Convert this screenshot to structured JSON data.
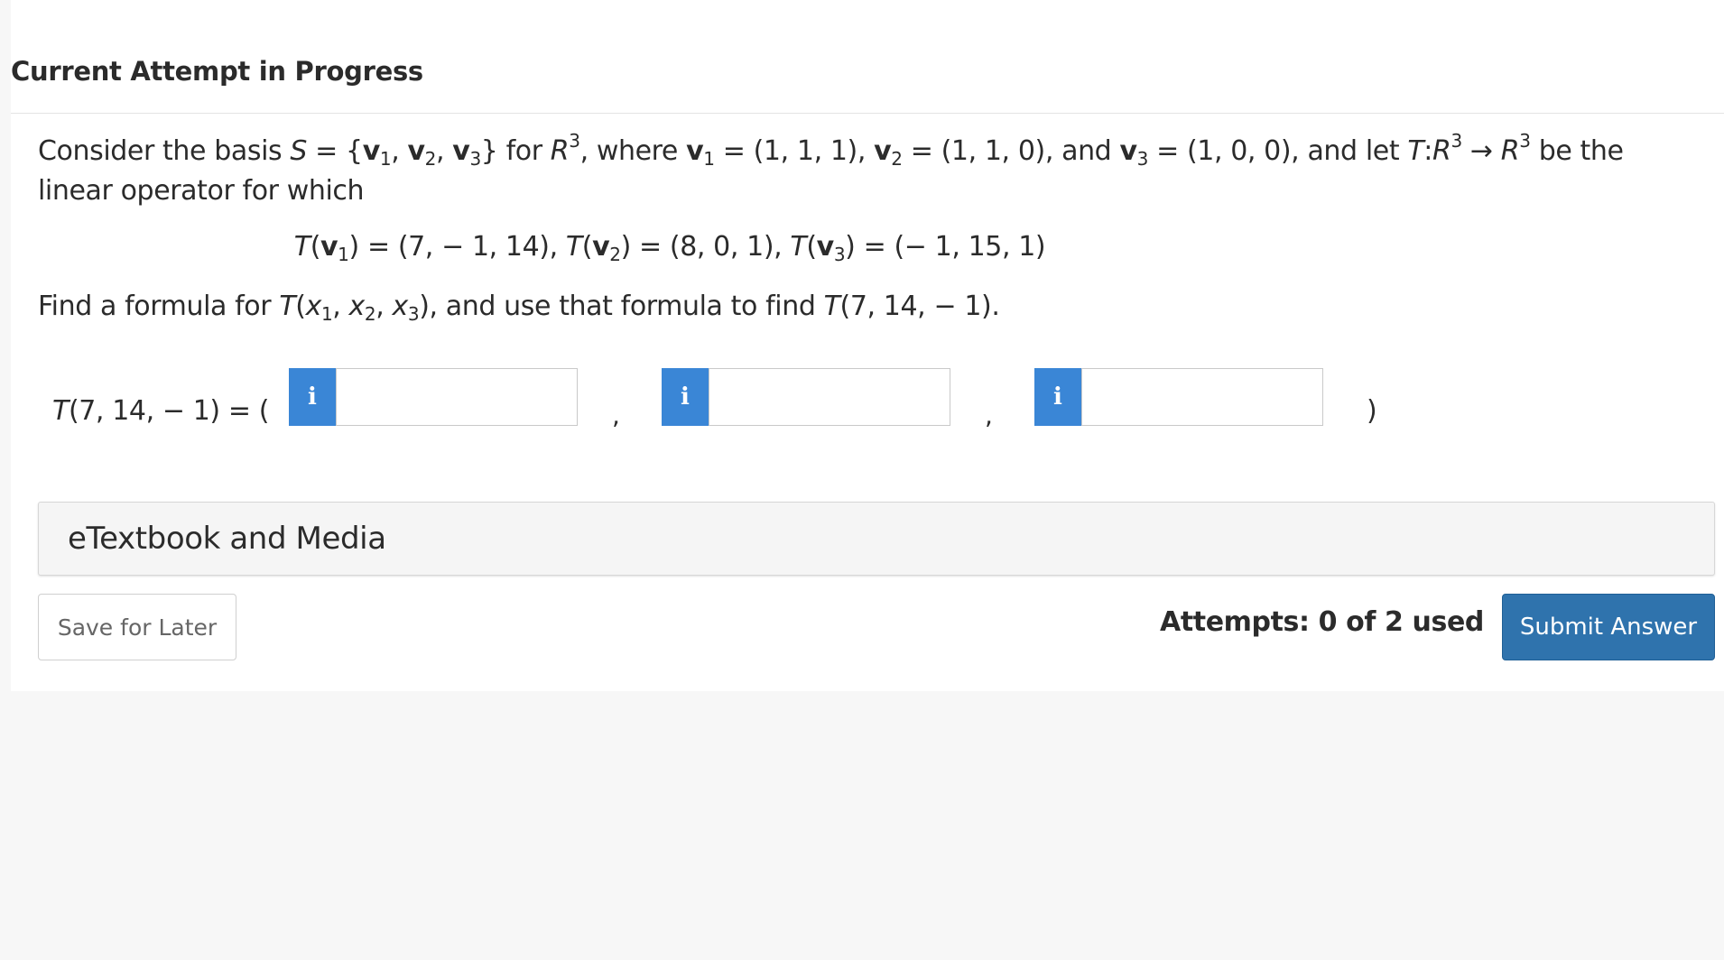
{
  "header": {
    "title": "Current Attempt in Progress"
  },
  "problem": {
    "intro": {
      "t1": "Consider the basis ",
      "S": "S",
      "t2": " = {",
      "v": "v",
      "s1": "1",
      "comma1": ", ",
      "s2": "2",
      "comma2": ", ",
      "s3": "3",
      "t3": "} for ",
      "R": "R",
      "exp3": "3",
      "t4": ", where ",
      "eq1": " = (1, 1, 1), ",
      "eq2": " = (1, 1, 0), and ",
      "eq3": " = (1, 0, 0), and let ",
      "T": "T",
      "colon": ":",
      "arrow": " → ",
      "t5": " be the linear operator for which"
    },
    "formula": {
      "T": "T",
      "open": "(",
      "v": "v",
      "s1": "1",
      "s2": "2",
      "s3": "3",
      "r1": ") = (7, − 1, 14), ",
      "r2": ") = (8, 0, 1), ",
      "r3": ") = (− 1, 15, 1)"
    },
    "question": {
      "t1": "Find a formula for ",
      "T": "T",
      "open": "(",
      "x": "x",
      "s1": "1",
      "sep": ", ",
      "s2": "2",
      "s3": "3",
      "t2": "), and use that formula to find ",
      "t3": "(7, 14, − 1)."
    }
  },
  "answer": {
    "lhs_T": "T",
    "lhs_rest": "(7, 14, − 1) = (",
    "info_glyph": "i",
    "comma": ",",
    "close": ")",
    "fields": [
      {
        "value": ""
      },
      {
        "value": ""
      },
      {
        "value": ""
      }
    ]
  },
  "media": {
    "title": "eTextbook and Media"
  },
  "footer": {
    "save_label": "Save for Later",
    "attempts_text": "Attempts: 0 of 2 used",
    "submit_label": "Submit Answer"
  },
  "colors": {
    "info_button": "#3a86d6",
    "submit_button": "#2f73ad",
    "panel_bg": "#f5f5f5"
  },
  "icons": {
    "info": "info-icon"
  }
}
